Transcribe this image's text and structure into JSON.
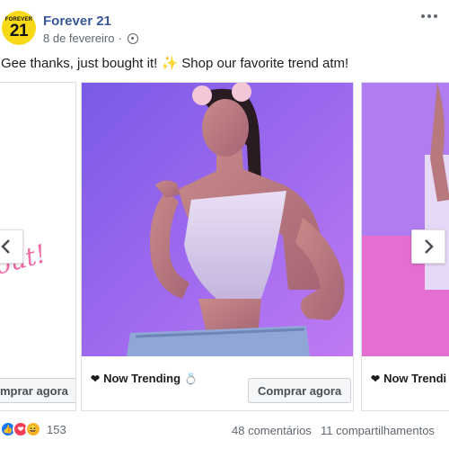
{
  "post": {
    "page_name": "Forever 21",
    "logo_top": "FOREVER",
    "logo_num": "21",
    "date": "8 de fevereiro",
    "caption": "Gee thanks, just bought it! ✨ Shop our favorite trend atm!"
  },
  "carousel": {
    "cards": [
      {
        "title": "",
        "button": "mprar agora",
        "script_text": "out!"
      },
      {
        "title": "Now Trending",
        "button": "Comprar agora"
      },
      {
        "title": "Now Trendi",
        "button": ""
      }
    ]
  },
  "footer": {
    "reaction_count": "153",
    "comments": "48 comentários",
    "shares": "11 compartilhamentos"
  },
  "colors": {
    "brand_yellow": "#f7d917",
    "link_blue": "#385898",
    "bg_purple": "#8c5ce8"
  }
}
